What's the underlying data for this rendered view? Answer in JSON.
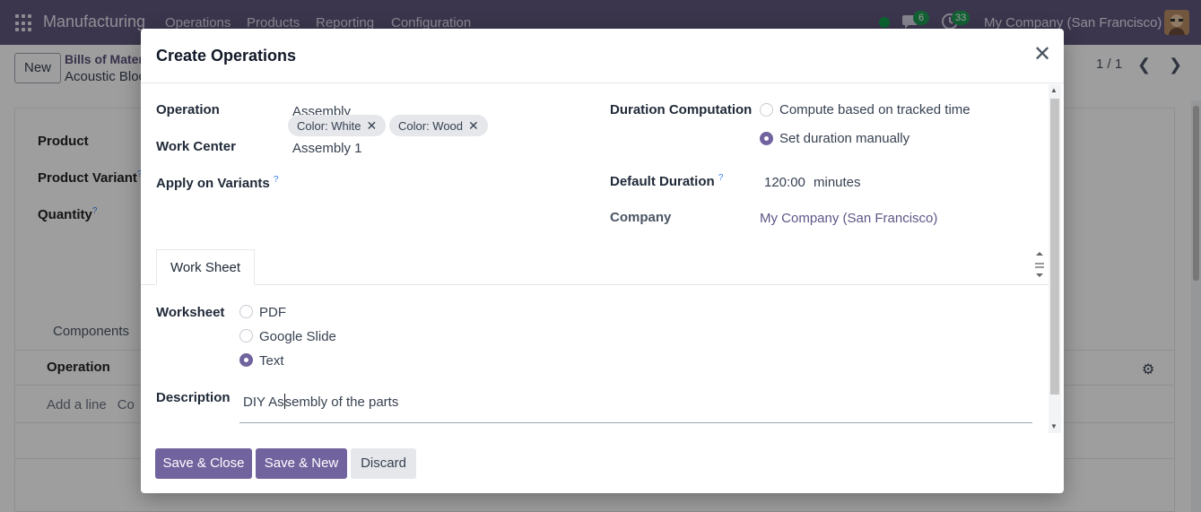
{
  "navbar": {
    "app_name": "Manufacturing",
    "menu": [
      "Operations",
      "Products",
      "Reporting",
      "Configuration"
    ],
    "messages_badge": "6",
    "activities_badge": "33",
    "company": "My Company (San Francisco)"
  },
  "background": {
    "new_label": "New",
    "breadcrumb_parent": "Bills of Materi",
    "breadcrumb_current": "Acoustic Bloc",
    "pager": "1 / 1",
    "fields": [
      "Product",
      "Product Variant",
      "Quantity"
    ],
    "help_mark": "?",
    "tab_components": "Components",
    "table_header_operation": "Operation",
    "add_line": "Add a line",
    "copy_link": "Co"
  },
  "modal": {
    "title": "Create Operations",
    "operation_label": "Operation",
    "operation_value": "Assembly",
    "work_center_label": "Work Center",
    "work_center_value": "Assembly 1",
    "apply_variants_label": "Apply on Variants",
    "variant_tags": [
      "Color: White",
      "Color: Wood"
    ],
    "duration_computation_label": "Duration Computation",
    "duration_options": [
      {
        "label": "Compute based on tracked time",
        "selected": false
      },
      {
        "label": "Set duration manually",
        "selected": true
      }
    ],
    "default_duration_label": "Default Duration",
    "default_duration_value": "120:00",
    "default_duration_unit": "minutes",
    "company_label": "Company",
    "company_value": "My Company (San Francisco)",
    "tab_label": "Work Sheet",
    "worksheet_label": "Worksheet",
    "worksheet_options": [
      {
        "label": "PDF",
        "selected": false
      },
      {
        "label": "Google Slide",
        "selected": false
      },
      {
        "label": "Text",
        "selected": true
      }
    ],
    "description_label": "Description",
    "description_before_caret": "DIY As",
    "description_after_caret": "sembly of the parts",
    "buttons": {
      "save_close": "Save & Close",
      "save_new": "Save & New",
      "discard": "Discard"
    }
  },
  "colors": {
    "navbar": "#60577d",
    "primary": "#71639e",
    "link": "#5f5587",
    "badge": "#1f9d55"
  }
}
